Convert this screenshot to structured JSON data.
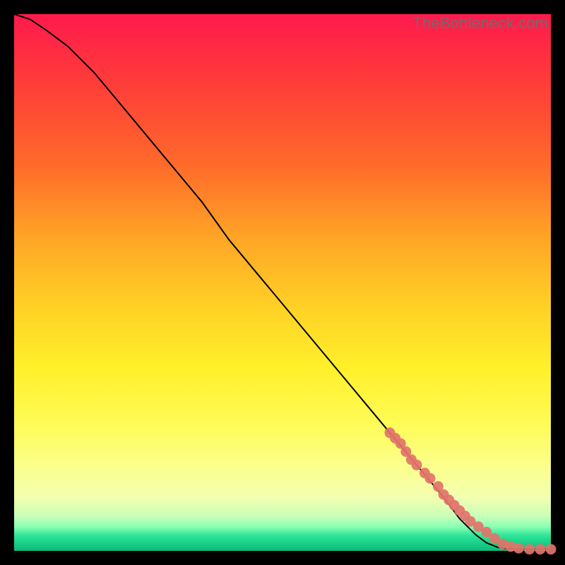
{
  "watermark": "TheBottleneck.com",
  "colors": {
    "curve": "#000000",
    "marker": "#e2736a",
    "marker_stroke": "#e2736a"
  },
  "chart_data": {
    "type": "line",
    "title": "",
    "xlabel": "",
    "ylabel": "",
    "xlim": [
      0,
      100
    ],
    "ylim": [
      0,
      100
    ],
    "grid": false,
    "legend": false,
    "series": [
      {
        "name": "bottleneck-curve",
        "x": [
          0,
          3,
          6,
          10,
          15,
          20,
          25,
          30,
          35,
          40,
          45,
          50,
          55,
          60,
          65,
          70,
          75,
          80,
          83,
          86,
          88,
          90,
          92,
          94,
          96,
          98,
          100
        ],
        "y": [
          100,
          99,
          97,
          94,
          89,
          83,
          77,
          71,
          65,
          58,
          52,
          46,
          40,
          34,
          28,
          22,
          16,
          10,
          6,
          3,
          1.5,
          0.7,
          0.4,
          0.3,
          0.3,
          0.3,
          0.3
        ]
      }
    ],
    "markers": {
      "name": "highlighted-segment",
      "x": [
        70,
        71,
        72,
        73,
        74,
        75,
        76.5,
        77.5,
        79,
        80,
        81,
        82,
        83,
        84,
        85,
        86.5,
        88,
        89.5,
        91,
        92.5,
        94,
        96,
        98,
        100
      ],
      "y": [
        22,
        21,
        20,
        18.5,
        17,
        16,
        14.5,
        13.5,
        12,
        10.5,
        9.5,
        8.5,
        7.5,
        6.5,
        5.5,
        4.5,
        3.5,
        2.3,
        1.3,
        0.8,
        0.5,
        0.3,
        0.3,
        0.3
      ]
    }
  }
}
